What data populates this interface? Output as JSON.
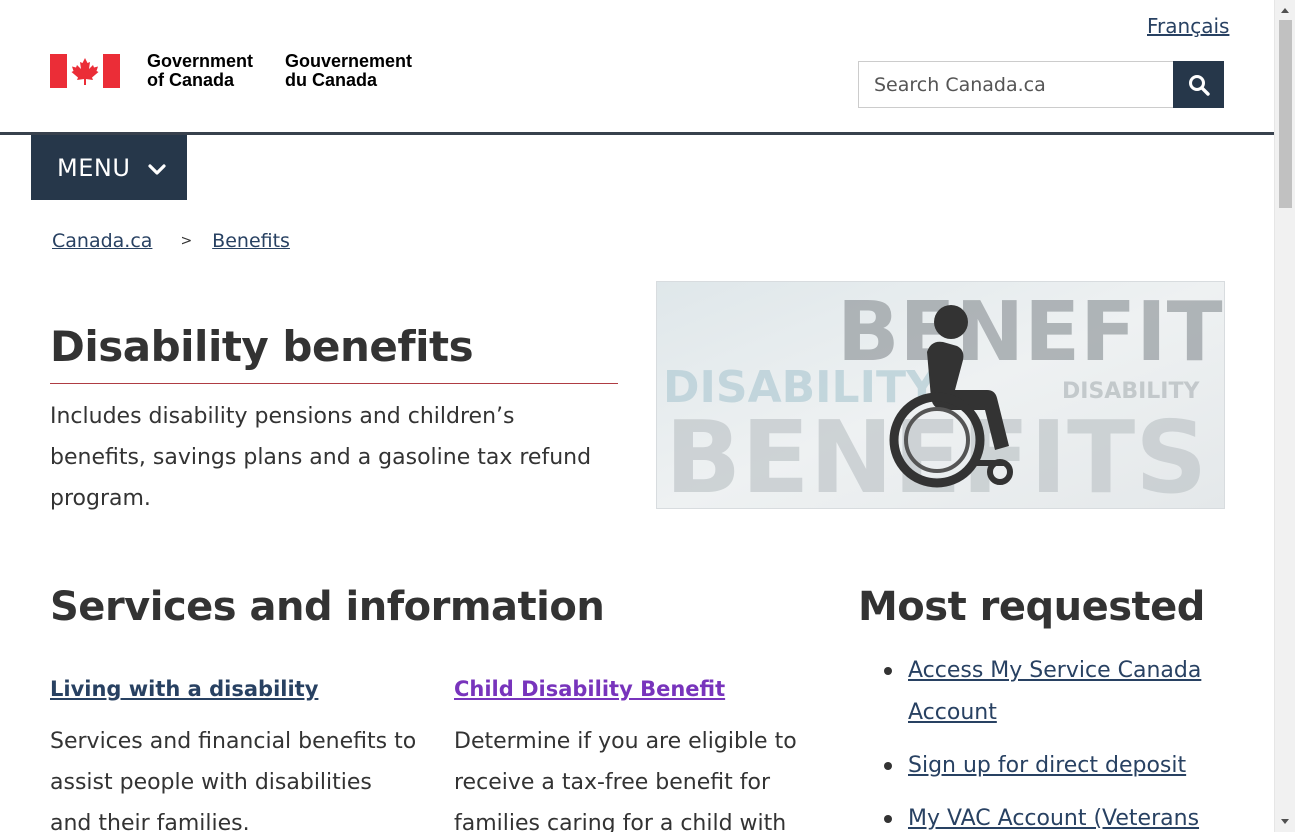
{
  "header": {
    "language_link": "Français",
    "gov_name_en_line1": "Government",
    "gov_name_en_line2": "of Canada",
    "gov_name_fr_line1": "Gouvernement",
    "gov_name_fr_line2": "du Canada",
    "search_placeholder": "Search Canada.ca",
    "search_icon": "search-icon",
    "menu_label": "MENU",
    "menu_icon": "chevron-down-icon"
  },
  "breadcrumb": {
    "items": [
      "Canada.ca",
      "Benefits"
    ],
    "separator": ">"
  },
  "page": {
    "title": "Disability benefits",
    "intro": "Includes disability pensions and children’s benefits, savings plans and a gasoline tax refund program."
  },
  "hero": {
    "word_large": "BENEFITS",
    "word_small": "DISABILITY",
    "icon": "wheelchair-icon"
  },
  "services": {
    "heading": "Services and information",
    "cards": [
      {
        "title": "Living with a disability",
        "description": "Services and financial benefits to assist people with disabilities and their families."
      },
      {
        "title": "Child Disability Benefit",
        "description": "Determine if you are eligible to receive a tax-free benefit for families caring for a child with"
      }
    ]
  },
  "most_requested": {
    "heading": "Most requested",
    "items": [
      "Access My Service Canada Account",
      "Sign up for direct deposit",
      "My VAC Account (Veterans"
    ]
  },
  "colors": {
    "brand_dark": "#26374a",
    "link": "#284162",
    "visited_link": "#7834bc",
    "title_rule": "#af3c43",
    "flag_red": "#eb2d37"
  }
}
